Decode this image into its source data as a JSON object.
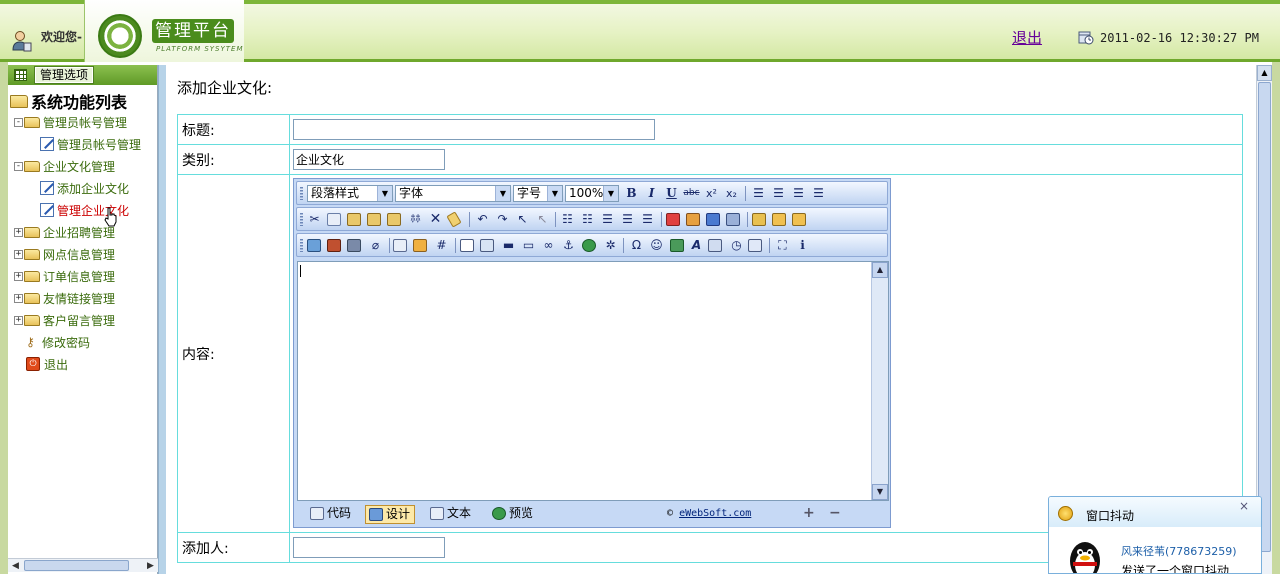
{
  "header": {
    "welcome": "欢迎您-",
    "logo_title": "管理平台",
    "logo_subtitle": "PLATFORM SYSYTEM",
    "logout": "退出",
    "datetime": "2011-02-16 12:30:27 PM"
  },
  "sidebar": {
    "head_label": "管理选项",
    "root_label": "系统功能列表",
    "items": [
      {
        "label": "管理员帐号管理",
        "expander": "-"
      },
      {
        "label": "管理员帐号管理"
      },
      {
        "label": "企业文化管理",
        "expander": "-"
      },
      {
        "label": "添加企业文化"
      },
      {
        "label": "管理企业文化"
      },
      {
        "label": "企业招聘管理",
        "expander": "+"
      },
      {
        "label": "网点信息管理",
        "expander": "+"
      },
      {
        "label": "订单信息管理",
        "expander": "+"
      },
      {
        "label": "友情链接管理",
        "expander": "+"
      },
      {
        "label": "客户留言管理",
        "expander": "+"
      },
      {
        "label": "修改密码"
      },
      {
        "label": "退出"
      }
    ]
  },
  "main": {
    "title": "添加企业文化:",
    "form": {
      "title_label": "标题:",
      "title_value": "",
      "category_label": "类别:",
      "category_value": "企业文化",
      "content_label": "内容:",
      "adder_label": "添加人:",
      "adder_value": ""
    }
  },
  "editor": {
    "paragraph_style": "段落样式",
    "font": "字体",
    "font_size": "字号",
    "zoom": "100%",
    "btn_bold": "B",
    "btn_italic": "I",
    "btn_underline": "U",
    "btn_strike": "abc",
    "btn_sup": "x²",
    "btn_sub": "x₂",
    "mode_code": "代码",
    "mode_design": "设计",
    "mode_text": "文本",
    "mode_preview": "预览",
    "copyright_symbol": "©",
    "copyright_link": "eWebSoft.com"
  },
  "qq": {
    "title": "窗口抖动",
    "close": "×",
    "name": "风来径苇",
    "number": "(778673259)",
    "message": "发送了一个窗口抖动"
  }
}
